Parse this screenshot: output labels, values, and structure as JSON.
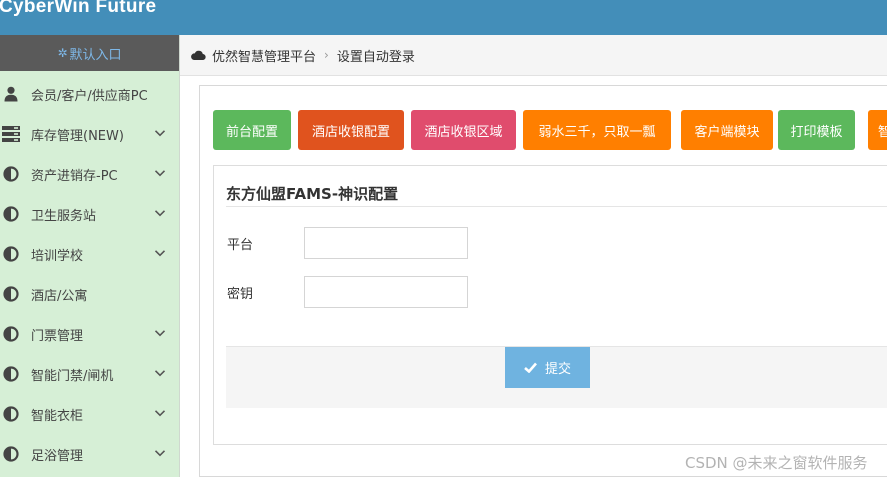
{
  "app": {
    "title": "CyberWin Future"
  },
  "sidebar": {
    "header_label": "默认入口",
    "items": [
      {
        "label": "会员/客户/供应商PC",
        "icon": "user-icon",
        "has_children": false
      },
      {
        "label": "库存管理(NEW)",
        "icon": "server-icon",
        "has_children": true
      },
      {
        "label": "资产进销存-PC",
        "icon": "adjust-icon",
        "has_children": true
      },
      {
        "label": "卫生服务站",
        "icon": "adjust-icon",
        "has_children": true
      },
      {
        "label": "培训学校",
        "icon": "adjust-icon",
        "has_children": true
      },
      {
        "label": "酒店/公寓",
        "icon": "adjust-icon",
        "has_children": false
      },
      {
        "label": "门票管理",
        "icon": "adjust-icon",
        "has_children": true
      },
      {
        "label": "智能门禁/闸机",
        "icon": "adjust-icon",
        "has_children": true
      },
      {
        "label": "智能衣柜",
        "icon": "adjust-icon",
        "has_children": true
      },
      {
        "label": "足浴管理",
        "icon": "adjust-icon",
        "has_children": true
      }
    ]
  },
  "breadcrumb": {
    "root": "优然智慧管理平台",
    "current": "设置自动登录"
  },
  "toolbar": {
    "buttons": [
      {
        "label": "前台配置",
        "color": "#5cb85c"
      },
      {
        "label": "酒店收银配置",
        "color": "#e0531e"
      },
      {
        "label": "酒店收银区域",
        "color": "#e04c6d"
      },
      {
        "label": "弱水三千，只取一瓢",
        "color": "#ff7f00"
      },
      {
        "label": "客户端模块",
        "color": "#ff7f00"
      },
      {
        "label": "打印模板",
        "color": "#5cb85c"
      },
      {
        "label": "智",
        "color": "#ff7f00"
      }
    ]
  },
  "form": {
    "title": "东方仙盟FAMS-神识配置",
    "fields": [
      {
        "label": "平台",
        "value": ""
      },
      {
        "label": "密钥",
        "value": ""
      }
    ],
    "submit_label": "提交"
  },
  "watermark": "CSDN @未来之窗软件服务",
  "colors": {
    "topbar": "#438eb9",
    "sidebar": "#d6efd6",
    "submit": "#6fb3e0"
  }
}
